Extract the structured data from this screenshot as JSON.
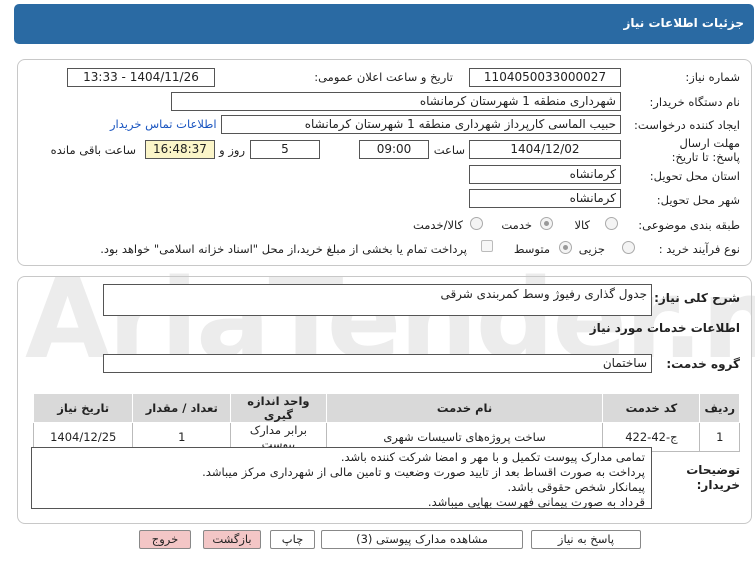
{
  "title": "جزئیات اطلاعات نیاز",
  "fields": {
    "need_number_label": "شماره نیاز:",
    "need_number": "1104050033000027",
    "announce_label": "تاریخ و ساعت اعلان عمومی:",
    "announce_value": "1404/11/26 - 13:33",
    "buyer_org_label": "نام دستگاه خریدار:",
    "buyer_org": "شهرداری منطقه 1 شهرستان کرمانشاه",
    "requester_label": "ایجاد کننده درخواست:",
    "requester": "حبیب الماسی کارپرداز شهرداری منطقه 1 شهرستان کرمانشاه",
    "buyer_contact_link": "اطلاعات تماس خریدار",
    "deadline_label": "مهلت ارسال پاسخ: تا تاریخ:",
    "deadline_date": "1404/12/02",
    "time_label": "ساعت",
    "deadline_time": "09:00",
    "days": "5",
    "days_and_label": "روز و",
    "remaining": "16:48:37",
    "remaining_label": "ساعت باقی مانده",
    "province_label": "استان محل تحویل:",
    "province": "کرمانشاه",
    "city_label": "شهر محل تحویل:",
    "city": "کرمانشاه",
    "category_label": "طبقه بندی موضوعی:",
    "category_options": [
      "کالا",
      "خدمت",
      "کالا/خدمت"
    ],
    "process_label": "نوع فرآیند خرید :",
    "process_options": [
      "جزیی",
      "متوسط"
    ],
    "payment_note": "پرداخت تمام یا بخشی از مبلغ خرید،از محل \"اسناد خزانه اسلامی\" خواهد بود."
  },
  "summary": {
    "label": "شرح کلی نیاز:",
    "value": "جدول گذاری رفیوژ وسط کمربندی شرقی"
  },
  "services": {
    "section_title": "اطلاعات خدمات مورد نیاز",
    "group_label": "گروه خدمت:",
    "group_value": "ساختمان",
    "columns": [
      "ردیف",
      "کد خدمت",
      "نام خدمت",
      "واحد اندازه گیری",
      "تعداد / مقدار",
      "تاریخ نیاز"
    ],
    "rows": [
      [
        "1",
        "ج-42-422",
        "ساخت پروژه‌های تاسیسات شهری",
        "برابر مدارک پیوست",
        "1",
        "1404/12/25"
      ]
    ]
  },
  "buyer_notes": {
    "label": "توضیحات خریدار:",
    "lines": [
      "تمامی مدارک پیوست تکمیل و با مهر و امضا شرکت کننده باشد.",
      "پرداخت به صورت اقساط بعد از تایید صورت وضعیت و تامین مالی از شهرداری مرکز میباشد.",
      "پیمانکار شخص حقوقی باشد.",
      "قرداد به صورت پیمانی فهرست بهایی میباشد."
    ]
  },
  "buttons": {
    "reply": "پاسخ به نیاز",
    "attachments": "مشاهده مدارک پیوستی (3)",
    "print": "چاپ",
    "back": "بازگشت",
    "exit": "خروج"
  },
  "watermark": "AriaTender.neT",
  "colors": {
    "titlebar": "#2a6aa3",
    "link": "#1a55c0",
    "back_button": "#f3c6c6"
  }
}
